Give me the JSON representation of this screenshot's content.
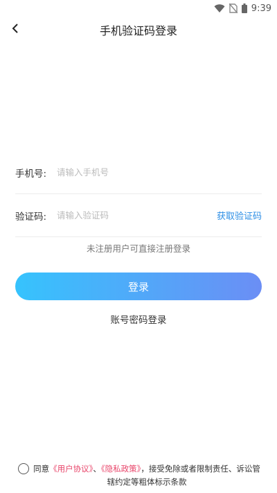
{
  "status_bar": {
    "time": "9:39",
    "icons": [
      "wifi-icon",
      "no-sim-icon",
      "battery-icon"
    ]
  },
  "header": {
    "title": "手机验证码登录",
    "back_icon": "chevron-left-icon"
  },
  "form": {
    "phone": {
      "label": "手机号:",
      "placeholder": "请输入手机号",
      "value": ""
    },
    "code": {
      "label": "验证码:",
      "placeholder": "请输入验证码",
      "value": "",
      "get_code_label": "获取验证码"
    }
  },
  "hint": "未注册用户可直接注册登录",
  "login_button": "登录",
  "alt_login": "账号密码登录",
  "agreement": {
    "prefix": "同意",
    "user_agreement": "《用户协议》",
    "separator": "、",
    "privacy_policy": "《隐私政策》",
    "suffix": "，接受免除或者限制责任、诉讼管辖约定等粗体标示条款"
  },
  "colors": {
    "accent": "#2c8ee5",
    "link": "#e8456a",
    "gradient_start": "#36c3fd",
    "gradient_end": "#6b8ef5"
  }
}
